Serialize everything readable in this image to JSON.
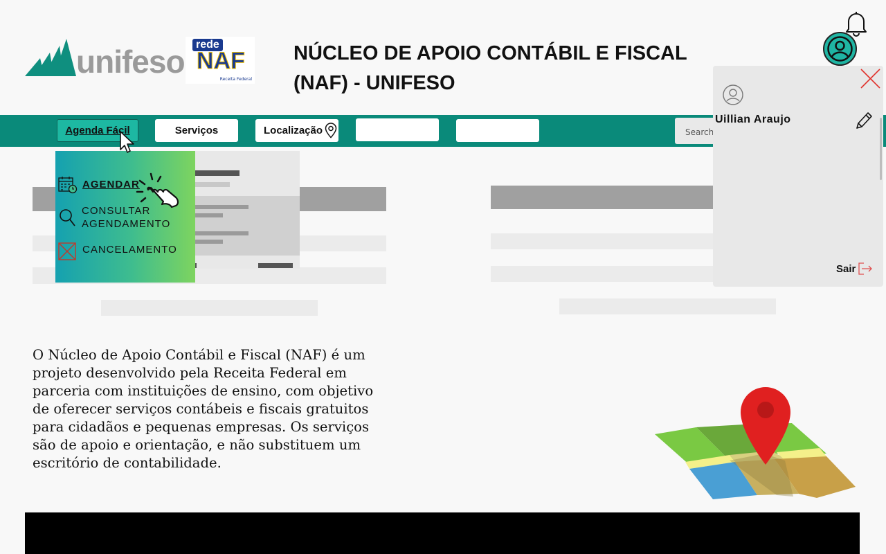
{
  "header": {
    "logo_unifeso_text": "unifeso",
    "logo_naf_rede": "rede",
    "logo_naf_text": "NAF",
    "logo_naf_sub": "Receita Federal",
    "title": "NÚCLEO DE APOIO CONTÁBIL E FISCAL (NAF) - UNIFESO"
  },
  "nav": {
    "agenda_label": "Agenda Fácil",
    "servicos_label": "Serviços",
    "localizacao_label": "Localização",
    "search_placeholder": "Search"
  },
  "dropdown": {
    "items": [
      {
        "label": "AGENDAR",
        "icon": "calendar-clock-icon"
      },
      {
        "label": "CONSULTAR AGENDAMENTO",
        "icon": "search-icon"
      },
      {
        "label": "CANCELAMENTO",
        "icon": "cancel-box-icon"
      }
    ]
  },
  "profile": {
    "name": "Uillian Araujo",
    "logout_label": "Sair"
  },
  "description": "O Núcleo de Apoio Contábil e Fiscal (NAF) é um projeto desenvolvido pela Receita Federal em parceria com instituições de ensino, com objetivo de oferecer serviços contábeis e fiscais gratuitos para cidadãos e pequenas empresas. Os serviços são de apoio e orientação, e não substituem um escritório de contabilidade.",
  "colors": {
    "nav_bg": "#0a8a7a",
    "accent": "#1fb5a3",
    "naf_blue": "#1a3a8f",
    "close_red": "#e0302a",
    "footer": "#000000"
  }
}
